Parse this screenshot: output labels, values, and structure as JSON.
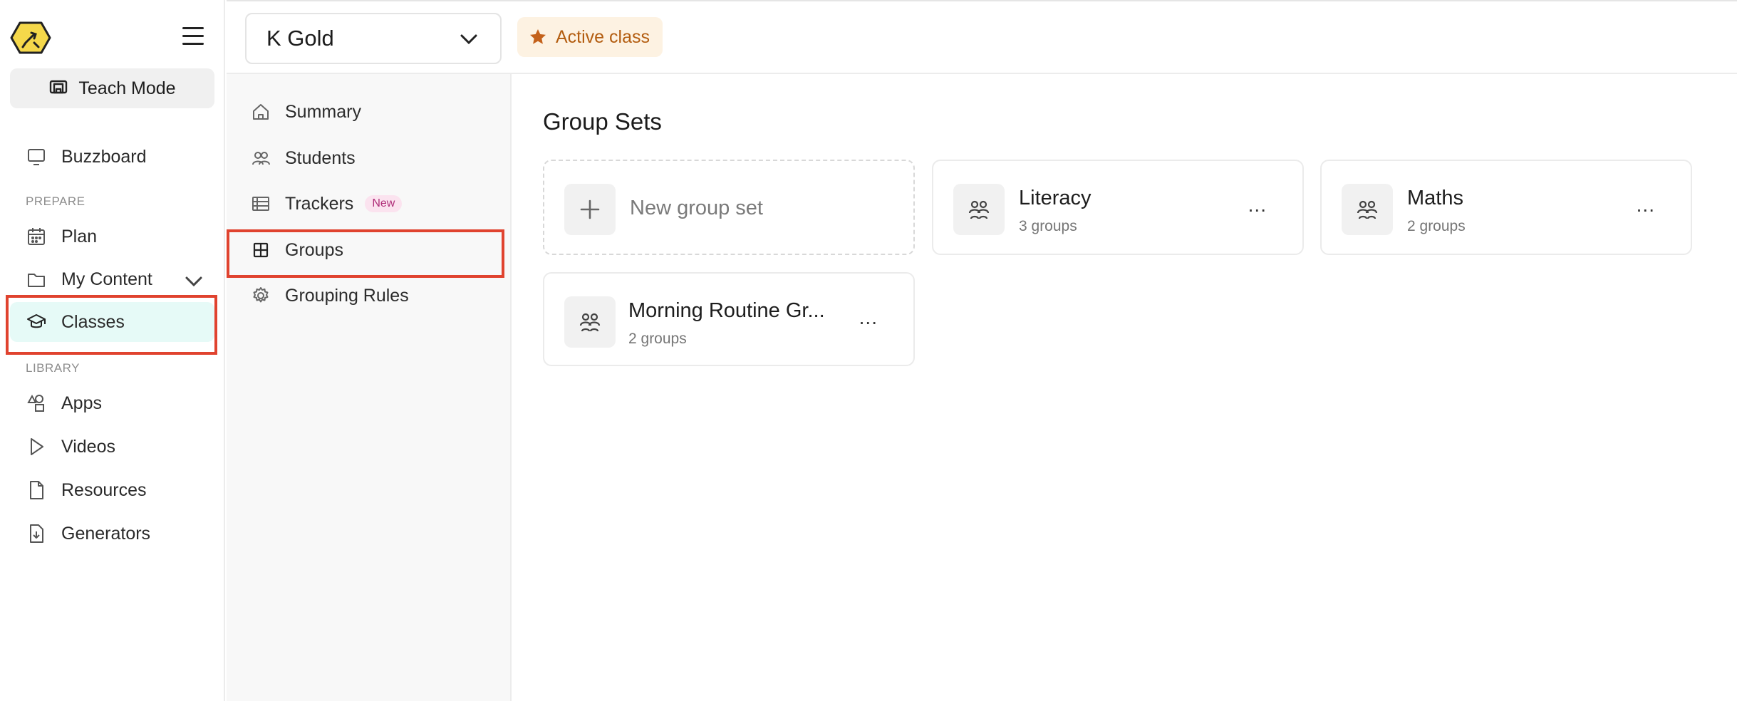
{
  "sidebar": {
    "teach_mode_label": "Teach Mode",
    "items": {
      "buzzboard": "Buzzboard",
      "plan": "Plan",
      "my_content": "My Content",
      "classes": "Classes",
      "apps": "Apps",
      "videos": "Videos",
      "resources": "Resources",
      "generators": "Generators"
    },
    "sections": {
      "prepare": "PREPARE",
      "library": "LIBRARY"
    }
  },
  "topbar": {
    "class_name": "K Gold",
    "active_badge": "Active class"
  },
  "subnav": {
    "items": {
      "summary": "Summary",
      "students": "Students",
      "trackers": "Trackers",
      "trackers_badge": "New",
      "groups": "Groups",
      "grouping_rules": "Grouping Rules"
    }
  },
  "main": {
    "title": "Group Sets",
    "new_group_set_label": "New group set",
    "cards": [
      {
        "title": "Literacy",
        "subtitle": "3 groups",
        "more": "..."
      },
      {
        "title": "Maths",
        "subtitle": "2 groups",
        "more": "..."
      },
      {
        "title": "Morning Routine Gr...",
        "subtitle": "2 groups",
        "more": "..."
      }
    ]
  },
  "colors": {
    "highlight": "#e0432f",
    "active_nav_bg": "#e6faf7",
    "badge_bg": "#fdf2e2",
    "badge_text": "#b35d10",
    "new_badge": "#b0307a"
  }
}
